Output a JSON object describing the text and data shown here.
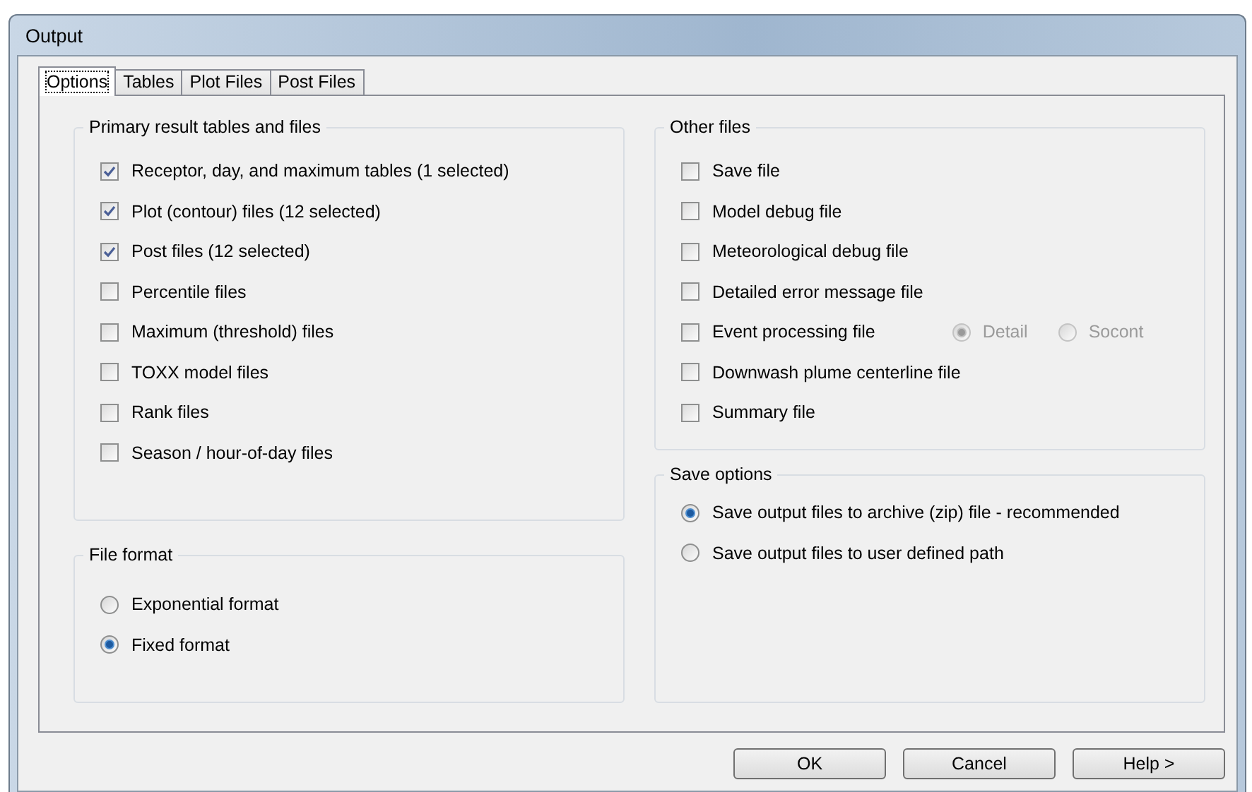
{
  "window": {
    "title": "Output"
  },
  "tabs": [
    {
      "label": "Options",
      "selected": true
    },
    {
      "label": "Tables",
      "selected": false
    },
    {
      "label": "Plot Files",
      "selected": false
    },
    {
      "label": "Post Files",
      "selected": false
    }
  ],
  "primary": {
    "title": "Primary result tables and files",
    "items": [
      {
        "label": "Receptor, day, and maximum tables (1 selected)",
        "checked": true
      },
      {
        "label": "Plot (contour) files (12 selected)",
        "checked": true
      },
      {
        "label": "Post files (12 selected)",
        "checked": true
      },
      {
        "label": "Percentile files",
        "checked": false
      },
      {
        "label": "Maximum (threshold) files",
        "checked": false
      },
      {
        "label": "TOXX model files",
        "checked": false
      },
      {
        "label": "Rank files",
        "checked": false
      },
      {
        "label": "Season / hour-of-day files",
        "checked": false
      }
    ]
  },
  "file_format": {
    "title": "File format",
    "options": [
      {
        "label": "Exponential format",
        "selected": false
      },
      {
        "label": "Fixed format",
        "selected": true
      }
    ]
  },
  "other_files": {
    "title": "Other files",
    "items": [
      {
        "label": "Save file",
        "checked": false
      },
      {
        "label": "Model debug file",
        "checked": false
      },
      {
        "label": "Meteorological debug file",
        "checked": false
      },
      {
        "label": "Detailed error message file",
        "checked": false
      },
      {
        "label": "Event processing file",
        "checked": false,
        "options": [
          {
            "label": "Detail",
            "selected": true,
            "disabled": true
          },
          {
            "label": "Socont",
            "selected": false,
            "disabled": true
          }
        ]
      },
      {
        "label": "Downwash plume centerline file",
        "checked": false
      },
      {
        "label": "Summary file",
        "checked": false
      }
    ]
  },
  "save_options": {
    "title": "Save options",
    "options": [
      {
        "label": "Save output files to archive (zip) file - recommended",
        "selected": true
      },
      {
        "label": "Save output files to user defined path",
        "selected": false
      }
    ]
  },
  "buttons": [
    "OK",
    "Cancel",
    "Help >"
  ]
}
